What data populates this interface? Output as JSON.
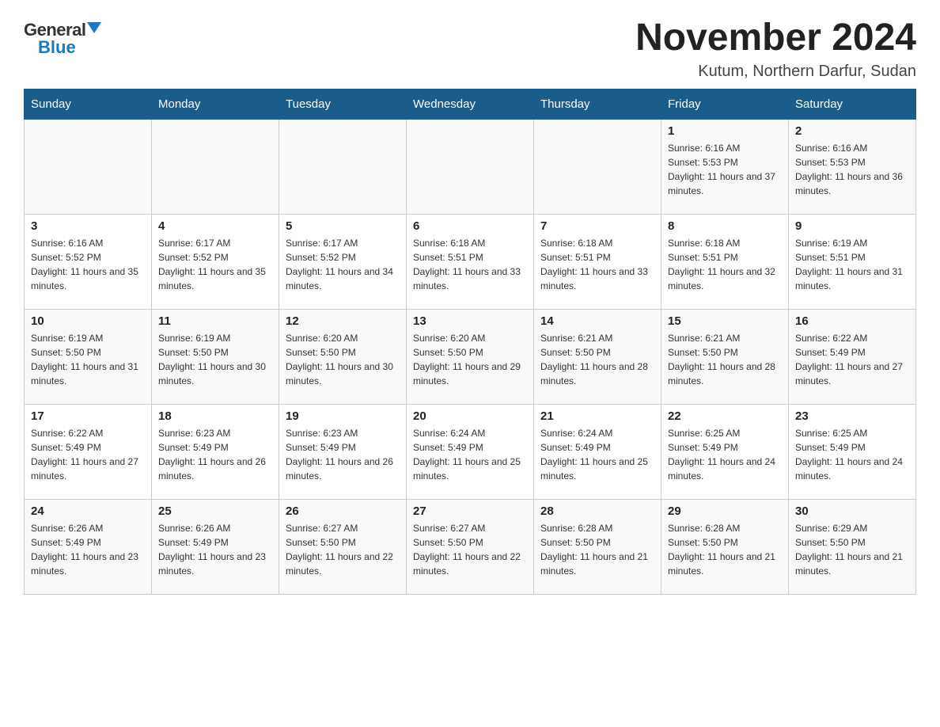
{
  "logo": {
    "general": "General",
    "triangle": "",
    "blue": "Blue"
  },
  "title": "November 2024",
  "location": "Kutum, Northern Darfur, Sudan",
  "days_of_week": [
    "Sunday",
    "Monday",
    "Tuesday",
    "Wednesday",
    "Thursday",
    "Friday",
    "Saturday"
  ],
  "weeks": [
    [
      {
        "day": "",
        "info": ""
      },
      {
        "day": "",
        "info": ""
      },
      {
        "day": "",
        "info": ""
      },
      {
        "day": "",
        "info": ""
      },
      {
        "day": "",
        "info": ""
      },
      {
        "day": "1",
        "info": "Sunrise: 6:16 AM\nSunset: 5:53 PM\nDaylight: 11 hours and 37 minutes."
      },
      {
        "day": "2",
        "info": "Sunrise: 6:16 AM\nSunset: 5:53 PM\nDaylight: 11 hours and 36 minutes."
      }
    ],
    [
      {
        "day": "3",
        "info": "Sunrise: 6:16 AM\nSunset: 5:52 PM\nDaylight: 11 hours and 35 minutes."
      },
      {
        "day": "4",
        "info": "Sunrise: 6:17 AM\nSunset: 5:52 PM\nDaylight: 11 hours and 35 minutes."
      },
      {
        "day": "5",
        "info": "Sunrise: 6:17 AM\nSunset: 5:52 PM\nDaylight: 11 hours and 34 minutes."
      },
      {
        "day": "6",
        "info": "Sunrise: 6:18 AM\nSunset: 5:51 PM\nDaylight: 11 hours and 33 minutes."
      },
      {
        "day": "7",
        "info": "Sunrise: 6:18 AM\nSunset: 5:51 PM\nDaylight: 11 hours and 33 minutes."
      },
      {
        "day": "8",
        "info": "Sunrise: 6:18 AM\nSunset: 5:51 PM\nDaylight: 11 hours and 32 minutes."
      },
      {
        "day": "9",
        "info": "Sunrise: 6:19 AM\nSunset: 5:51 PM\nDaylight: 11 hours and 31 minutes."
      }
    ],
    [
      {
        "day": "10",
        "info": "Sunrise: 6:19 AM\nSunset: 5:50 PM\nDaylight: 11 hours and 31 minutes."
      },
      {
        "day": "11",
        "info": "Sunrise: 6:19 AM\nSunset: 5:50 PM\nDaylight: 11 hours and 30 minutes."
      },
      {
        "day": "12",
        "info": "Sunrise: 6:20 AM\nSunset: 5:50 PM\nDaylight: 11 hours and 30 minutes."
      },
      {
        "day": "13",
        "info": "Sunrise: 6:20 AM\nSunset: 5:50 PM\nDaylight: 11 hours and 29 minutes."
      },
      {
        "day": "14",
        "info": "Sunrise: 6:21 AM\nSunset: 5:50 PM\nDaylight: 11 hours and 28 minutes."
      },
      {
        "day": "15",
        "info": "Sunrise: 6:21 AM\nSunset: 5:50 PM\nDaylight: 11 hours and 28 minutes."
      },
      {
        "day": "16",
        "info": "Sunrise: 6:22 AM\nSunset: 5:49 PM\nDaylight: 11 hours and 27 minutes."
      }
    ],
    [
      {
        "day": "17",
        "info": "Sunrise: 6:22 AM\nSunset: 5:49 PM\nDaylight: 11 hours and 27 minutes."
      },
      {
        "day": "18",
        "info": "Sunrise: 6:23 AM\nSunset: 5:49 PM\nDaylight: 11 hours and 26 minutes."
      },
      {
        "day": "19",
        "info": "Sunrise: 6:23 AM\nSunset: 5:49 PM\nDaylight: 11 hours and 26 minutes."
      },
      {
        "day": "20",
        "info": "Sunrise: 6:24 AM\nSunset: 5:49 PM\nDaylight: 11 hours and 25 minutes."
      },
      {
        "day": "21",
        "info": "Sunrise: 6:24 AM\nSunset: 5:49 PM\nDaylight: 11 hours and 25 minutes."
      },
      {
        "day": "22",
        "info": "Sunrise: 6:25 AM\nSunset: 5:49 PM\nDaylight: 11 hours and 24 minutes."
      },
      {
        "day": "23",
        "info": "Sunrise: 6:25 AM\nSunset: 5:49 PM\nDaylight: 11 hours and 24 minutes."
      }
    ],
    [
      {
        "day": "24",
        "info": "Sunrise: 6:26 AM\nSunset: 5:49 PM\nDaylight: 11 hours and 23 minutes."
      },
      {
        "day": "25",
        "info": "Sunrise: 6:26 AM\nSunset: 5:49 PM\nDaylight: 11 hours and 23 minutes."
      },
      {
        "day": "26",
        "info": "Sunrise: 6:27 AM\nSunset: 5:50 PM\nDaylight: 11 hours and 22 minutes."
      },
      {
        "day": "27",
        "info": "Sunrise: 6:27 AM\nSunset: 5:50 PM\nDaylight: 11 hours and 22 minutes."
      },
      {
        "day": "28",
        "info": "Sunrise: 6:28 AM\nSunset: 5:50 PM\nDaylight: 11 hours and 21 minutes."
      },
      {
        "day": "29",
        "info": "Sunrise: 6:28 AM\nSunset: 5:50 PM\nDaylight: 11 hours and 21 minutes."
      },
      {
        "day": "30",
        "info": "Sunrise: 6:29 AM\nSunset: 5:50 PM\nDaylight: 11 hours and 21 minutes."
      }
    ]
  ]
}
